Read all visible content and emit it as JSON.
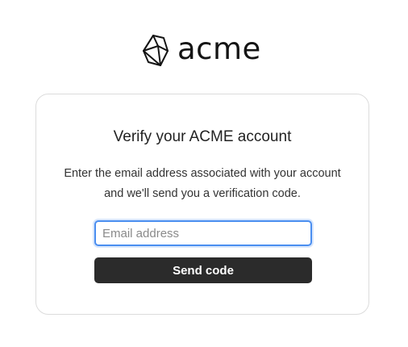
{
  "brand": {
    "name": "acme",
    "logo_icon": "polyhedron-logo-icon"
  },
  "card": {
    "title": "Verify your ACME account",
    "description": "Enter the email address associated with your account and we'll send you a verification code."
  },
  "form": {
    "email_value": "",
    "email_placeholder": "Email address",
    "submit_label": "Send code"
  },
  "colors": {
    "input_focus_border": "#4a8ef0",
    "button_background": "#2b2b2b",
    "button_text": "#ffffff",
    "card_border": "#dcdcdc"
  }
}
